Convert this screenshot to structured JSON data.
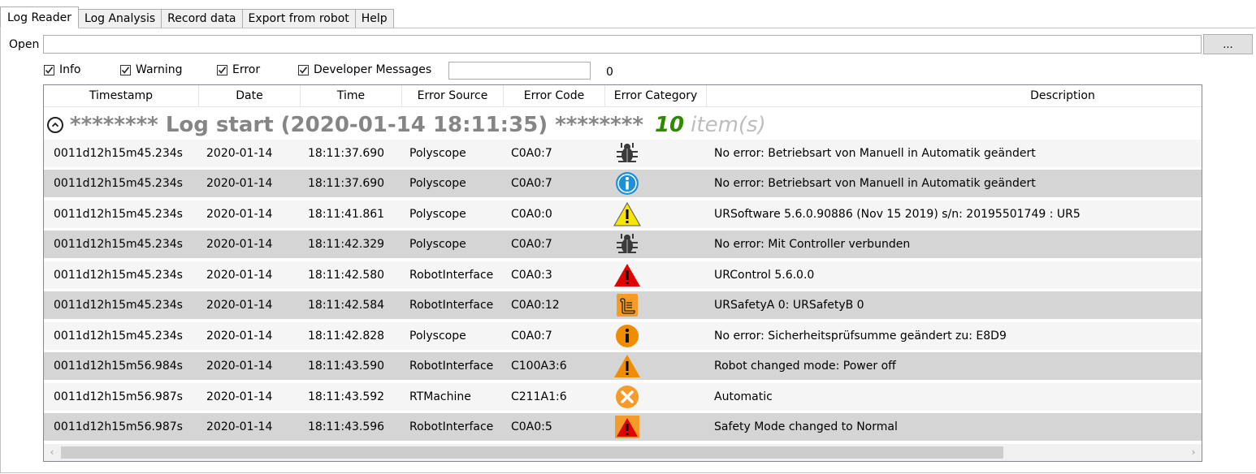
{
  "tabs": [
    {
      "label": "Log Reader",
      "active": true
    },
    {
      "label": "Log Analysis"
    },
    {
      "label": "Record data"
    },
    {
      "label": "Export from robot"
    },
    {
      "label": "Help"
    }
  ],
  "open": {
    "label": "Open",
    "value": "",
    "browse_label": "..."
  },
  "filters": [
    {
      "label": "Info",
      "checked": true
    },
    {
      "label": "Warning",
      "checked": true
    },
    {
      "label": "Error",
      "checked": true
    },
    {
      "label": "Developer Messages",
      "checked": true
    }
  ],
  "search": {
    "value": ""
  },
  "count": "0",
  "columns": [
    "Timestamp",
    "Date",
    "Time",
    "Error Source",
    "Error Code",
    "Error Category",
    "Description"
  ],
  "group": {
    "title": "******** Log start (2020-01-14 18:11:35) ********",
    "count": "10",
    "items_label": "item(s)"
  },
  "rows": [
    {
      "timestamp": "0011d12h15m45.234s",
      "date": "2020-01-14",
      "time": "18:11:37.690",
      "source": "Polyscope",
      "code": "C0A0:7",
      "category": "bug-icon",
      "description": "No error: Betriebsart von Manuell in Automatik geändert"
    },
    {
      "timestamp": "0011d12h15m45.234s",
      "date": "2020-01-14",
      "time": "18:11:37.690",
      "source": "Polyscope",
      "code": "C0A0:7",
      "category": "info-blue-icon",
      "description": "No error: Betriebsart von Manuell in Automatik geändert"
    },
    {
      "timestamp": "0011d12h15m45.234s",
      "date": "2020-01-14",
      "time": "18:11:41.861",
      "source": "Polyscope",
      "code": "C0A0:0",
      "category": "warning-yellow-icon",
      "description": "URSoftware 5.6.0.90886 (Nov 15 2019) s/n: 20195501749 : UR5"
    },
    {
      "timestamp": "0011d12h15m45.234s",
      "date": "2020-01-14",
      "time": "18:11:42.329",
      "source": "Polyscope",
      "code": "C0A0:7",
      "category": "bug-icon",
      "description": "No error: Mit Controller verbunden"
    },
    {
      "timestamp": "0011d12h15m45.234s",
      "date": "2020-01-14",
      "time": "18:11:42.580",
      "source": "RobotInterface",
      "code": "C0A0:3",
      "category": "error-red-icon",
      "description": "URControl 5.6.0.0"
    },
    {
      "timestamp": "0011d12h15m45.234s",
      "date": "2020-01-14",
      "time": "18:11:42.584",
      "source": "RobotInterface",
      "code": "C0A0:12",
      "category": "scroll-icon",
      "description": "URSafetyA 0: URSafetyB 0"
    },
    {
      "timestamp": "0011d12h15m45.234s",
      "date": "2020-01-14",
      "time": "18:11:42.828",
      "source": "Polyscope",
      "code": "C0A0:7",
      "category": "info-orange-icon",
      "description": "No error: Sicherheitsprüfsumme geändert zu: E8D9"
    },
    {
      "timestamp": "0011d12h15m56.984s",
      "date": "2020-01-14",
      "time": "18:11:43.590",
      "source": "RobotInterface",
      "code": "C100A3:6",
      "category": "warning-orange-icon",
      "description": "Robot changed mode: Power off"
    },
    {
      "timestamp": "0011d12h15m56.987s",
      "date": "2020-01-14",
      "time": "18:11:43.592",
      "source": "RTMachine",
      "code": "C211A1:6",
      "category": "close-orange-icon",
      "description": "Automatic"
    },
    {
      "timestamp": "0011d12h15m56.987s",
      "date": "2020-01-14",
      "time": "18:11:43.596",
      "source": "RobotInterface",
      "code": "C0A0:5",
      "category": "safety-warning-icon",
      "description": "Safety Mode changed to Normal"
    }
  ],
  "colors": {
    "group_count": "#2e8b00",
    "group_title": "#858585",
    "row_alt": "#d5d5d5"
  }
}
